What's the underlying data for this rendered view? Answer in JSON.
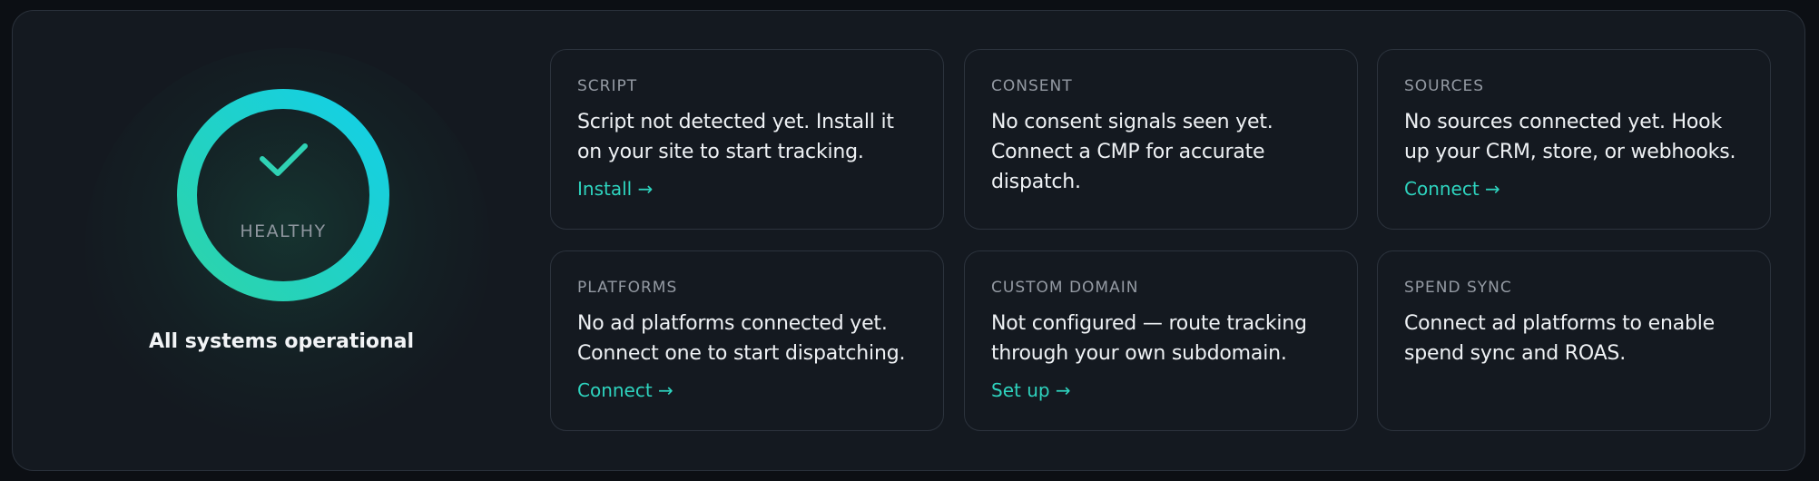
{
  "status": {
    "ring_label": "HEALTHY",
    "message": "All systems operational",
    "ring_color_start": "#2dd4a8",
    "ring_color_end": "#13cfe8",
    "check_icon": "check-icon"
  },
  "cards": [
    {
      "label": "SCRIPT",
      "description": "Script not detected yet. Install it on your site to start tracking.",
      "link": "Install →"
    },
    {
      "label": "CONSENT",
      "description": "No consent signals seen yet. Connect a CMP for accurate dispatch."
    },
    {
      "label": "SOURCES",
      "description": "No sources connected yet. Hook up your CRM, store, or webhooks.",
      "link": "Connect →"
    },
    {
      "label": "PLATFORMS",
      "description": "No ad platforms connected yet. Connect one to start dispatching.",
      "link": "Connect →"
    },
    {
      "label": "CUSTOM DOMAIN",
      "description": "Not configured — route tracking through your own subdomain.",
      "link": "Set up →"
    },
    {
      "label": "SPEND SYNC",
      "description": "Connect ad platforms to enable spend sync and ROAS."
    }
  ],
  "colors": {
    "accent": "#2ed3be",
    "background": "#0c0f14",
    "panel": "#141920"
  }
}
